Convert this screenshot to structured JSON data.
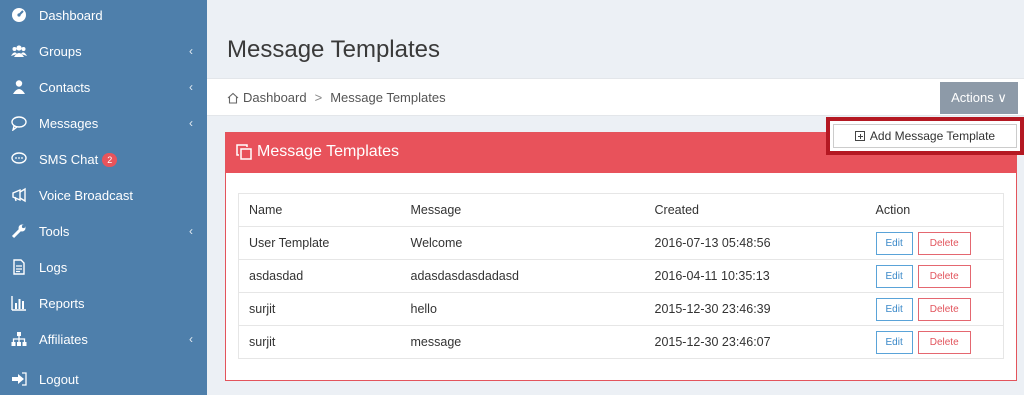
{
  "sidebar": {
    "items": [
      {
        "label": "Dashboard",
        "icon": "dashboard-icon",
        "chevron": ""
      },
      {
        "label": "Groups",
        "icon": "users-icon",
        "chevron": "‹"
      },
      {
        "label": "Contacts",
        "icon": "user-icon",
        "chevron": "‹"
      },
      {
        "label": "Messages",
        "icon": "chat-bubble-icon",
        "chevron": "‹"
      },
      {
        "label": "SMS Chat",
        "icon": "sms-chat-icon",
        "chevron": "",
        "badge": "2"
      },
      {
        "label": "Voice Broadcast",
        "icon": "megaphone-icon",
        "chevron": ""
      },
      {
        "label": "Tools",
        "icon": "wrench-icon",
        "chevron": "‹"
      },
      {
        "label": "Logs",
        "icon": "document-icon",
        "chevron": ""
      },
      {
        "label": "Reports",
        "icon": "bar-chart-icon",
        "chevron": ""
      },
      {
        "label": "Affiliates",
        "icon": "sitemap-icon",
        "chevron": "‹"
      },
      {
        "label": "Logout",
        "icon": "logout-icon",
        "chevron": ""
      }
    ]
  },
  "main": {
    "title": "Message Templates",
    "breadcrumb": {
      "home": "Dashboard",
      "separator": ">",
      "current": "Message Templates"
    },
    "actions_label": "Actions ∨",
    "add_button_label": "Add Message Template",
    "panel_title": "Message Templates",
    "table": {
      "headers": [
        "Name",
        "Message",
        "Created",
        "Action"
      ],
      "rows": [
        {
          "name": "User Template",
          "message": "Welcome",
          "created": "2016-07-13 05:48:56"
        },
        {
          "name": "asdasdad",
          "message": "adasdasdasdadasd",
          "created": "2016-04-11 10:35:13"
        },
        {
          "name": "surjit",
          "message": "hello",
          "created": "2015-12-30 23:46:39"
        },
        {
          "name": "surjit",
          "message": "message",
          "created": "2015-12-30 23:46:07"
        }
      ],
      "edit_label": "Edit",
      "delete_label": "Delete"
    }
  },
  "colors": {
    "sidebar_bg": "#4e7fab",
    "panel_header": "#e8525b",
    "highlight_border": "#b41822",
    "actions_bg": "#8d9aa8",
    "edit_border": "#5aa3d8",
    "delete_border": "#e46770"
  }
}
